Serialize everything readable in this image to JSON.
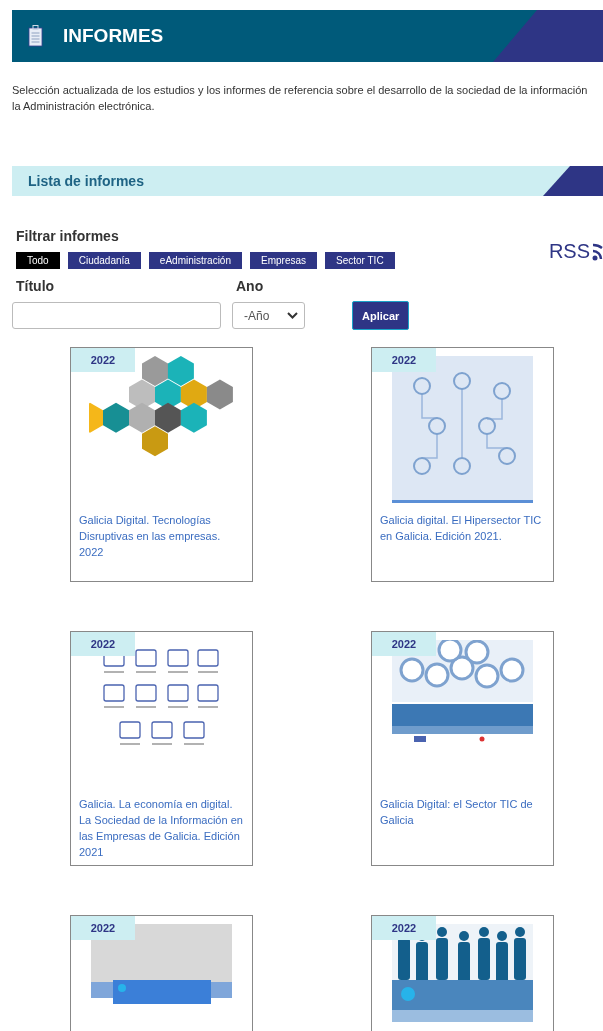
{
  "header": {
    "title": "INFORMES"
  },
  "description": [
    "Selección actualizada de los estudios y los informes de referencia sobre el desarrollo de la sociedad de la información",
    "la Administración electrónica."
  ],
  "section": {
    "title": "Lista de informes"
  },
  "filters": {
    "title": "Filtrar informes",
    "chips": [
      {
        "label": "Todo",
        "selected": true
      },
      {
        "label": "Ciudadanía",
        "selected": false
      },
      {
        "label": "eAdministración",
        "selected": false
      },
      {
        "label": "Empresas",
        "selected": false
      },
      {
        "label": "Sector TIC",
        "selected": false
      }
    ],
    "rss": "RSS",
    "title_field": {
      "label": "Título"
    },
    "year_field": {
      "label": "Ano",
      "value": "-Año"
    },
    "apply": "Aplicar"
  },
  "reports": [
    {
      "year": "2022",
      "kind": "hexagons",
      "title": "Galicia Digital. Tecnologías Disruptivas en las empresas. 2022"
    },
    {
      "year": "2022",
      "kind": "circuit",
      "title": "Galicia digital. El Hipersector TIC en Galicia. Edición 2021."
    },
    {
      "year": "2022",
      "kind": "icons",
      "title": "Galicia. La economía en digital. La Sociedad de la Información en las Empresas de Galicia. Edición 2021"
    },
    {
      "year": "2022",
      "kind": "gears",
      "title": "Galicia Digital: el Sector TIC de Galicia"
    },
    {
      "year": "2022",
      "kind": "photo"
    },
    {
      "year": "2022",
      "kind": "silhouettes"
    }
  ]
}
